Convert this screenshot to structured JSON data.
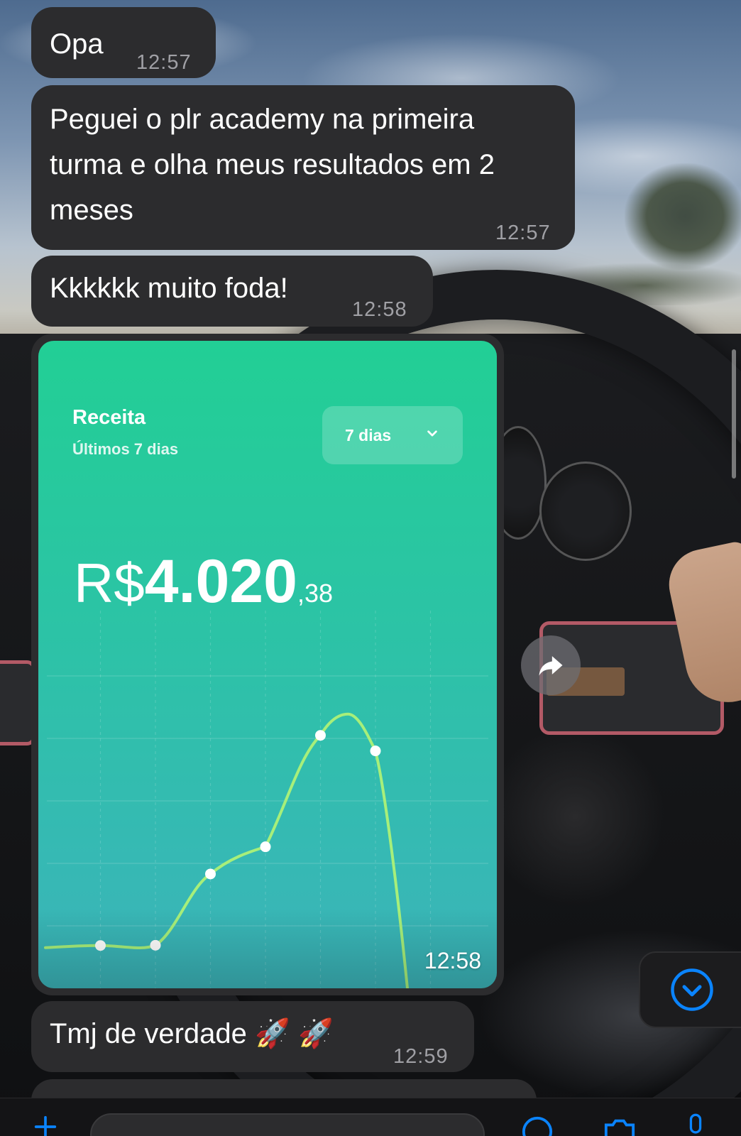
{
  "messages": [
    {
      "text": "Opa",
      "time": "12:57"
    },
    {
      "text_lines": [
        "Peguei o plr academy na primeira",
        "turma e olha meus resultados em 2",
        "meses"
      ],
      "time": "12:57"
    },
    {
      "text": "Kkkkkk muito foda!",
      "time": "12:58"
    },
    {
      "text": "Tmj de verdade 🚀 🚀",
      "time": "12:59"
    }
  ],
  "image_message": {
    "time": "12:58",
    "card": {
      "title": "Receita",
      "subtitle": "Últimos 7 dias",
      "period_label": "7 dias",
      "currency": "R$",
      "amount_main": "4.020",
      "amount_cents": ",38"
    }
  },
  "chart_data": {
    "type": "line",
    "title": "Receita",
    "subtitle": "Últimos 7 dias",
    "x": [
      1,
      2,
      3,
      4,
      5,
      6
    ],
    "values": [
      0.9,
      1.0,
      28.5,
      39.0,
      82.0,
      76.0
    ],
    "grid": true,
    "colors": {
      "line": "#a7ef7a",
      "points": "#ffffff"
    }
  },
  "icons": {
    "forward": "forward-arrow-icon",
    "scroll_down": "chevron-down-circle-icon",
    "period_chevron": "chevron-down-icon"
  },
  "colors": {
    "bubble": "#2c2c2e",
    "accent_blue": "#0a84ff",
    "card_green": "#22cf95"
  }
}
